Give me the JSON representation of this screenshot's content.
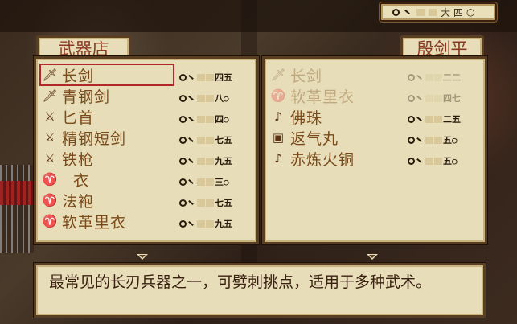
{
  "money": {
    "amount": "四",
    "digits": [
      "□",
      "□",
      "大",
      "四",
      "○"
    ]
  },
  "shop": {
    "title": "武器店",
    "items": [
      {
        "icon": "sword-icon",
        "glyph": "🗡",
        "name": "长剑",
        "price": "四五",
        "selected": true
      },
      {
        "icon": "sword-icon",
        "glyph": "🗡",
        "name": "青钢剑",
        "price": "八○",
        "selected": false
      },
      {
        "icon": "dagger-icon",
        "glyph": "⚔",
        "name": "匕首",
        "price": "四○",
        "selected": false
      },
      {
        "icon": "dagger-icon",
        "glyph": "⚔",
        "name": "精钢短剑",
        "price": "七五",
        "selected": false
      },
      {
        "icon": "spear-icon",
        "glyph": "⚔",
        "name": "铁枪",
        "price": "九五",
        "selected": false
      },
      {
        "icon": "robe-icon",
        "glyph": "♈",
        "name": "  衣",
        "price": "三○",
        "selected": false
      },
      {
        "icon": "robe-icon",
        "glyph": "♈",
        "name": "法袍",
        "price": "七五",
        "selected": false
      },
      {
        "icon": "robe-icon",
        "glyph": "♈",
        "name": "软革里衣",
        "price": "九五",
        "selected": false
      }
    ]
  },
  "character": {
    "name": "殷剑平",
    "items": [
      {
        "icon": "sword-icon",
        "glyph": "🗡",
        "name": "长剑",
        "price": "二二",
        "dim": true
      },
      {
        "icon": "robe-icon",
        "glyph": "♈",
        "name": "软革里衣",
        "price": "四七",
        "dim": true
      },
      {
        "icon": "bead-icon",
        "glyph": "♪",
        "name": "佛珠",
        "price": "二五",
        "dim": false
      },
      {
        "icon": "pill-icon",
        "glyph": "▣",
        "name": "返气丸",
        "price": "五○",
        "dim": false
      },
      {
        "icon": "bead-icon",
        "glyph": "♪",
        "name": "赤炼火铜",
        "price": "五○",
        "dim": false
      }
    ]
  },
  "description": "最常见的长刃兵器之一，可劈刺挑点，适用于多种武术。"
}
